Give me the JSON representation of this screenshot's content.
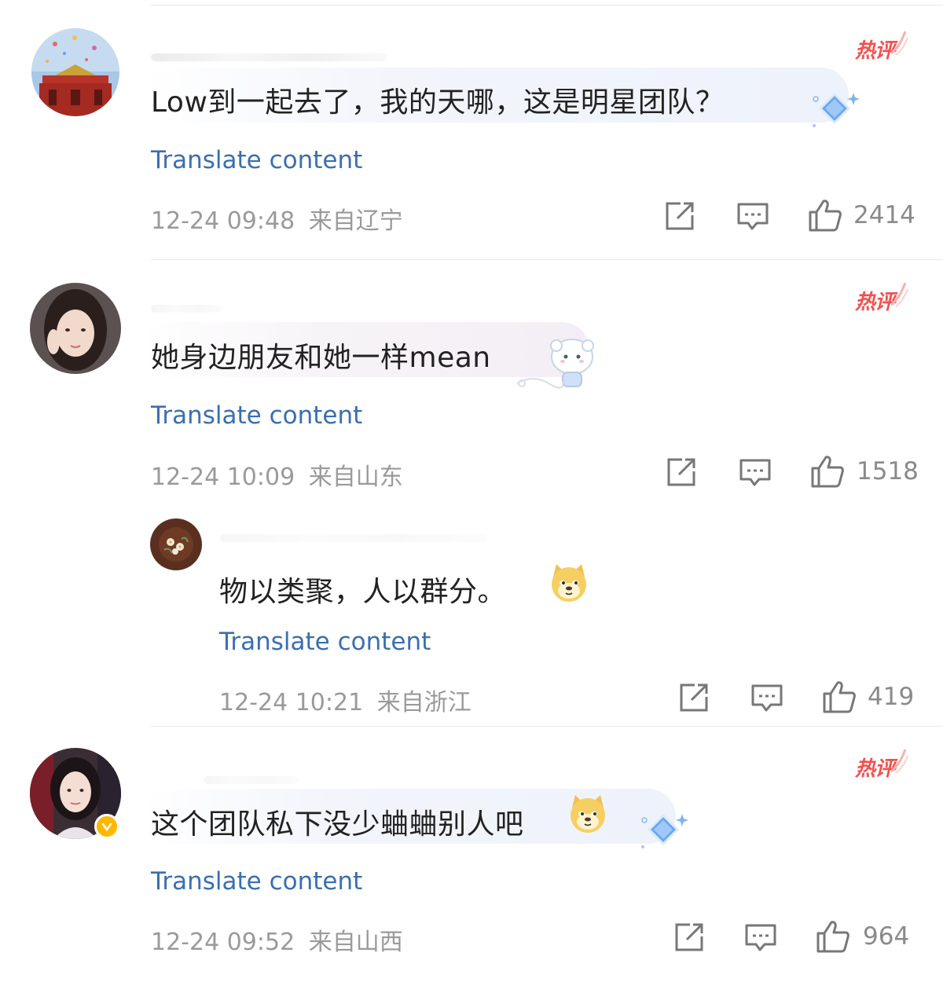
{
  "comments": [
    {
      "badge": "热评",
      "text": "Low到一起去了，我的天哪，这是明星团队？",
      "translate": "Translate content",
      "time": "12-24 09:48",
      "location": "来自辽宁",
      "likes": "2414"
    },
    {
      "badge": "热评",
      "text": "她身边朋友和她一样mean",
      "translate": "Translate content",
      "time": "12-24 10:09",
      "location": "来自山东",
      "likes": "1518"
    },
    {
      "badge": "",
      "text": "物以类聚，人以群分。",
      "translate": "Translate content",
      "time": "12-24 10:21",
      "location": "来自浙江",
      "likes": "419"
    },
    {
      "badge": "热评",
      "text": "这个团队私下没少蛐蛐别人吧",
      "translate": "Translate content",
      "time": "12-24 09:52",
      "location": "来自山西",
      "likes": "964"
    }
  ],
  "colors": {
    "accent_link": "#3a6fb0",
    "hot_badge": "#f0524f",
    "meta_text": "#9a9a9a",
    "verified": "#ffb800"
  },
  "icons": [
    "share-icon",
    "reply-icon",
    "like-icon",
    "doge-emoji-icon",
    "verified-icon",
    "diamond-decoration-icon",
    "cat-decoration-icon"
  ]
}
